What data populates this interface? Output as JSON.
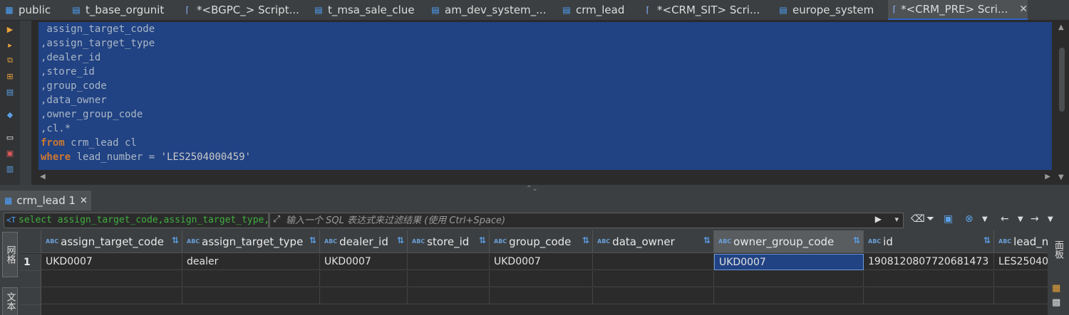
{
  "tabs": [
    {
      "label": "public",
      "icon": "schema-icon"
    },
    {
      "label": "t_base_orgunit",
      "icon": "table-icon"
    },
    {
      "label": "*<BGPC_> Script...",
      "icon": "script-icon"
    },
    {
      "label": "t_msa_sale_clue",
      "icon": "table-icon"
    },
    {
      "label": "am_dev_system_...",
      "icon": "table-icon"
    },
    {
      "label": "crm_lead",
      "icon": "table-icon"
    },
    {
      "label": "*<CRM_SIT> Scri...",
      "icon": "script-icon"
    },
    {
      "label": "europe_system",
      "icon": "table-icon"
    },
    {
      "label": "*<CRM_PRE> Scri...",
      "icon": "script-icon"
    }
  ],
  "active_tab_close": "✕",
  "editor": {
    "lines": [
      {
        "text": " assign_target_code"
      },
      {
        "text": ",assign_target_type"
      },
      {
        "text": ",dealer_id"
      },
      {
        "text": ",store_id"
      },
      {
        "text": ",group_code"
      },
      {
        "text": ",data_owner"
      },
      {
        "text": ",owner_group_code"
      },
      {
        "text": ",cl.*"
      },
      {
        "kw": "from",
        "text": " crm_lead cl"
      },
      {
        "kw": "where",
        "text": " lead_number = ",
        "str": "'LES2504000459'"
      }
    ]
  },
  "result_tab": {
    "label": "crm_lead 1",
    "close": "✕"
  },
  "filter": {
    "sql_preview": "select assign_target_code,assign_target_type,c",
    "placeholder": "输入一个 SQL 表达式来过滤结果 (使用 Ctrl+Space)"
  },
  "left_side_tabs": [
    "网格",
    "文本"
  ],
  "right_side_label": "面板",
  "grid": {
    "type_badge": "ABC",
    "columns": [
      "assign_target_code",
      "assign_target_type",
      "dealer_id",
      "store_id",
      "group_code",
      "data_owner",
      "owner_group_code",
      "id",
      "lead_nu"
    ],
    "rows": [
      {
        "num": "1",
        "cells": [
          "UKD0007",
          "dealer",
          "UKD0007",
          "",
          "UKD0007",
          "",
          "UKD0007",
          "1908120807720681473",
          "LES25040"
        ]
      }
    ],
    "selected": {
      "row": 0,
      "col": 6
    }
  }
}
